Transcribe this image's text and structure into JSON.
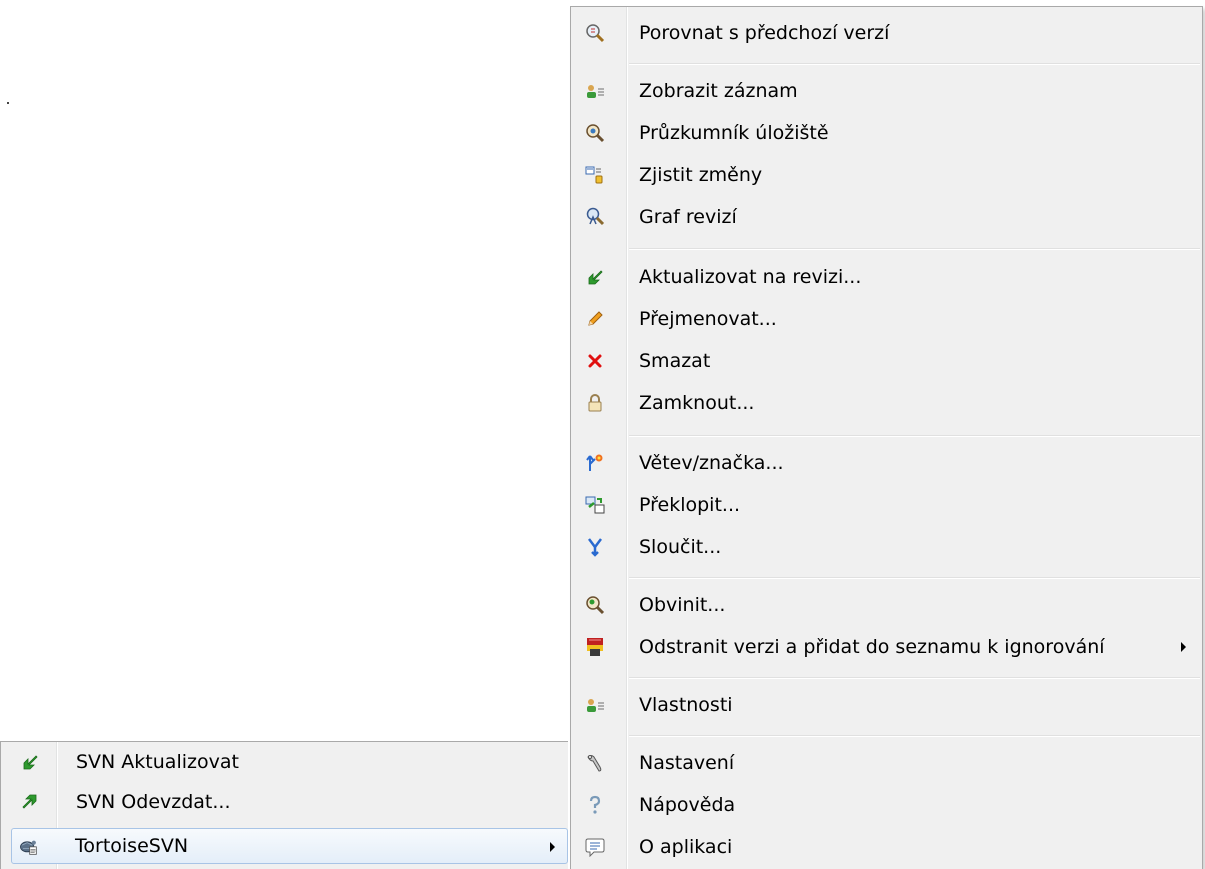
{
  "left_menu": {
    "items": [
      {
        "label": "SVN Aktualizovat",
        "icon": "svn-update-icon"
      },
      {
        "label": "SVN Odevzdat...",
        "icon": "svn-commit-icon"
      },
      {
        "label": "TortoiseSVN",
        "icon": "tortoisesvn-icon",
        "has_submenu": true,
        "highlighted": true
      }
    ]
  },
  "submenu": {
    "items": [
      {
        "label": "Porovnat s předchozí verzí",
        "icon": "diff-magnifier-icon"
      },
      {
        "label": "Zobrazit záznam",
        "icon": "show-log-icon"
      },
      {
        "label": "Průzkumník úložiště",
        "icon": "repo-browser-icon"
      },
      {
        "label": "Zjistit změny",
        "icon": "check-modifications-icon"
      },
      {
        "label": "Graf revizí",
        "icon": "revision-graph-icon"
      },
      {
        "label": "Aktualizovat na revizi...",
        "icon": "update-to-revision-icon"
      },
      {
        "label": "Přejmenovat...",
        "icon": "rename-pencil-icon"
      },
      {
        "label": "Smazat",
        "icon": "delete-x-icon"
      },
      {
        "label": "Zamknout...",
        "icon": "lock-icon"
      },
      {
        "label": "Větev/značka...",
        "icon": "branch-tag-icon"
      },
      {
        "label": "Překlopit...",
        "icon": "switch-icon"
      },
      {
        "label": "Sloučit...",
        "icon": "merge-icon"
      },
      {
        "label": "Obvinit...",
        "icon": "blame-icon"
      },
      {
        "label": "Odstranit verzi a přidat do seznamu k ignorování",
        "icon": "unversion-ignore-icon",
        "has_submenu": true
      },
      {
        "label": "Vlastnosti",
        "icon": "properties-icon"
      },
      {
        "label": "Nastavení",
        "icon": "settings-icon"
      },
      {
        "label": "Nápověda",
        "icon": "help-icon"
      },
      {
        "label": "O aplikaci",
        "icon": "about-icon"
      }
    ]
  },
  "colors": {
    "menu_background": "#f0f0f0",
    "highlight_border": "#a8c4e6",
    "delete_red": "#e01010",
    "update_green": "#2e9a2e"
  }
}
